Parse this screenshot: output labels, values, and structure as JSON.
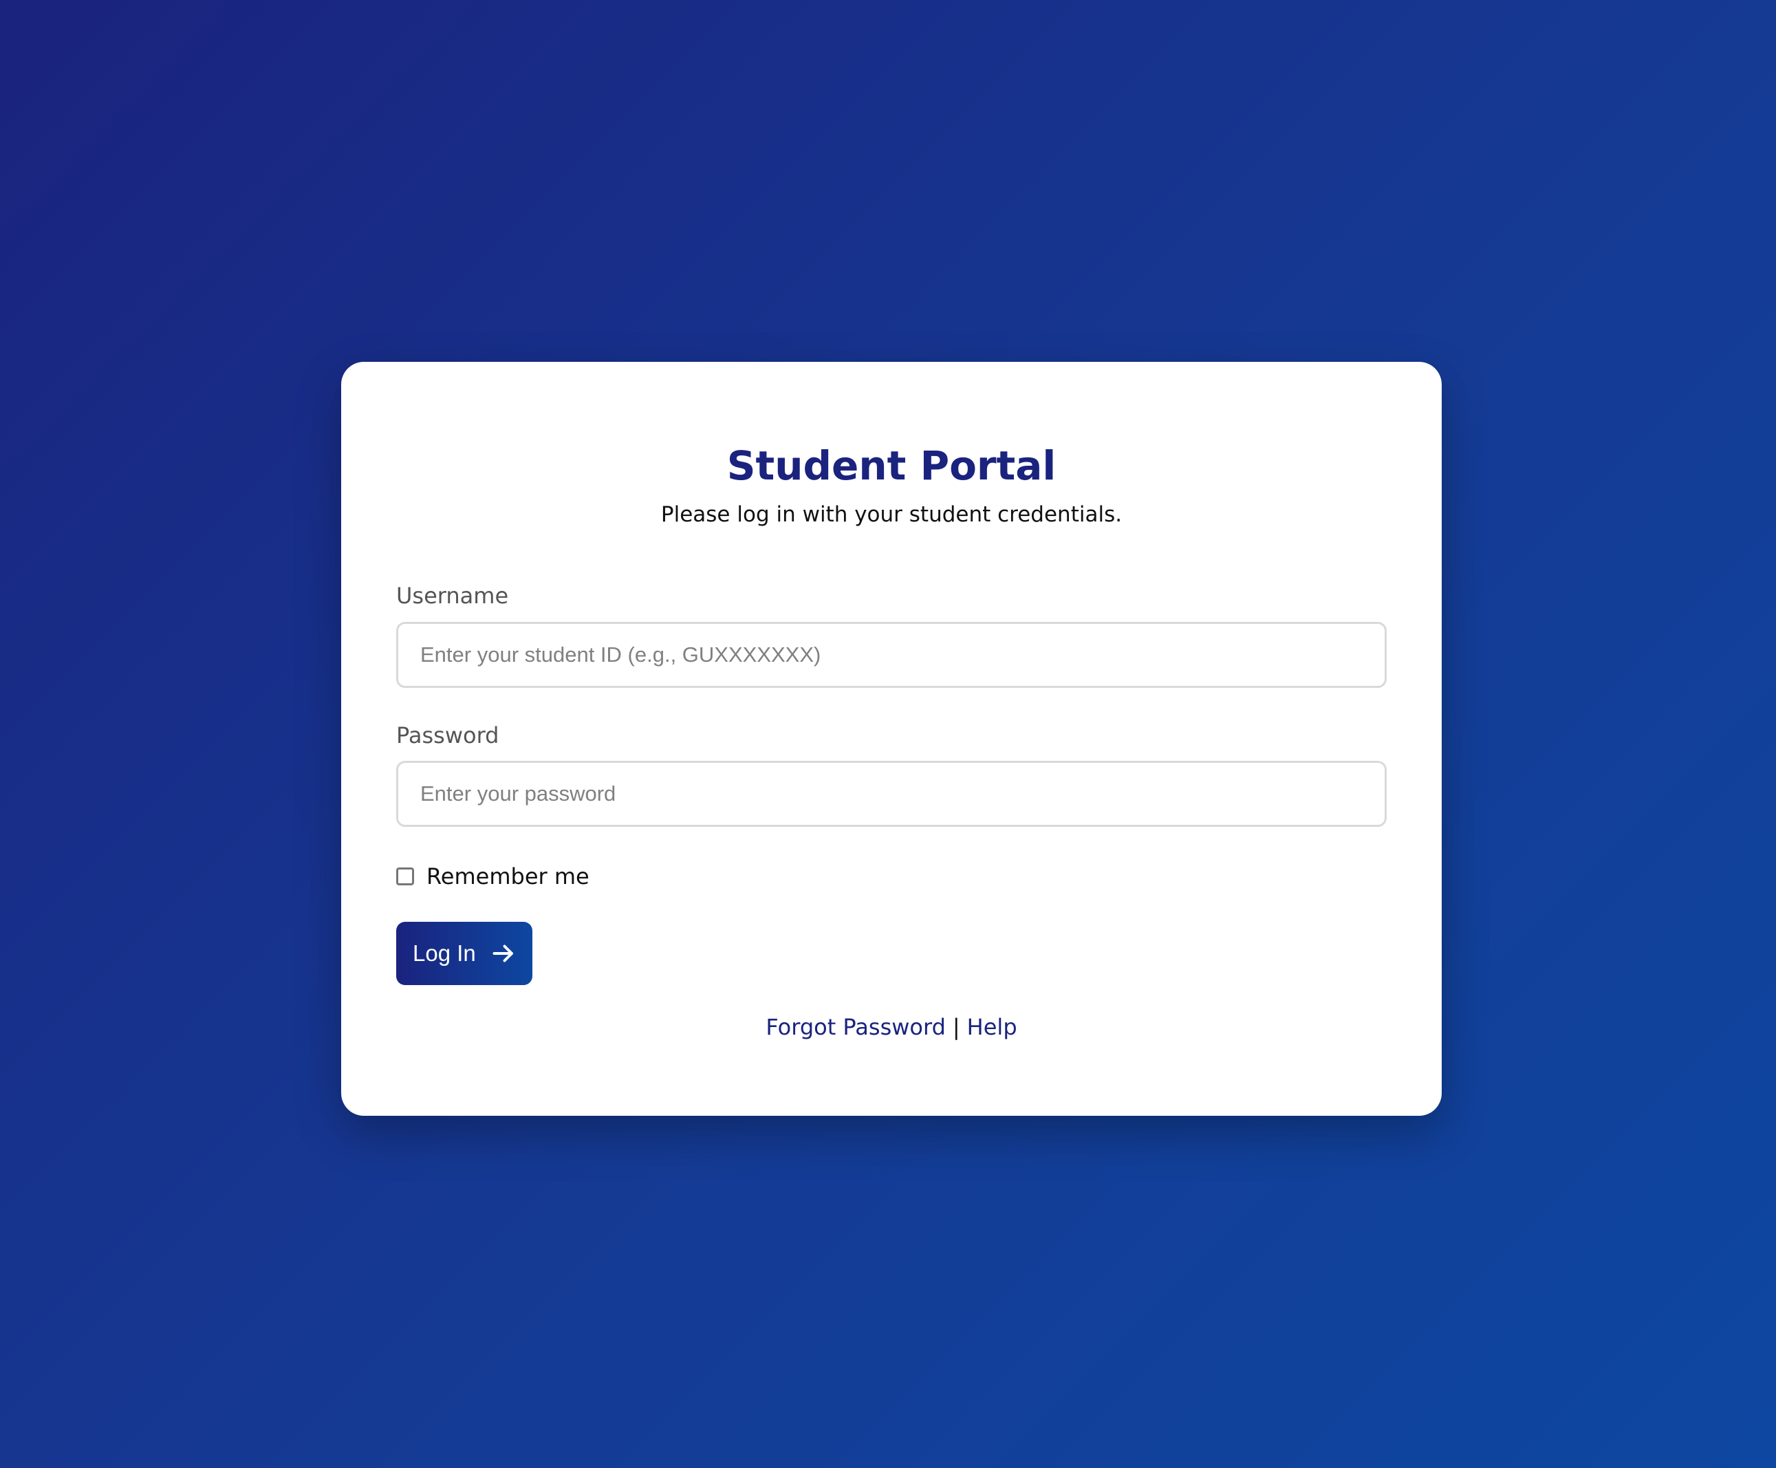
{
  "login": {
    "title": "Student Portal",
    "subtitle": "Please log in with your student credentials.",
    "username": {
      "label": "Username",
      "value": "",
      "placeholder": "Enter your student ID (e.g., GUXXXXXXX)"
    },
    "password": {
      "label": "Password",
      "value": "",
      "placeholder": "Enter your password"
    },
    "remember": {
      "label": "Remember me",
      "checked": false
    },
    "submit": {
      "label": "Log In",
      "icon": "arrow-right-icon"
    },
    "links": {
      "forgot": "Forgot Password",
      "separator": "|",
      "help": "Help"
    }
  },
  "colors": {
    "brand": "#1a237e",
    "background_start": "#1a237e",
    "background_end": "#0d47a1",
    "card": "#ffffff"
  }
}
